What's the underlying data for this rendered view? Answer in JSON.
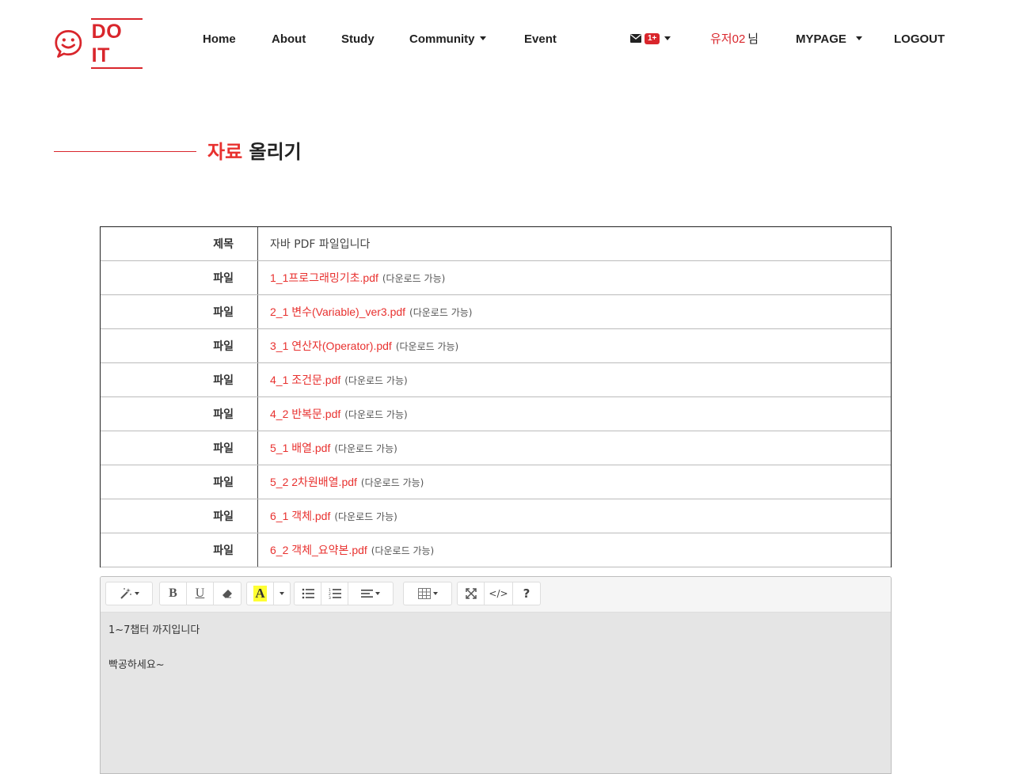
{
  "brand": {
    "name": "DO IT",
    "color": "#d9262c"
  },
  "nav": {
    "items": [
      "Home",
      "About",
      "Study",
      "Community",
      "Event"
    ],
    "message_badge": "1+",
    "user_name": "유저02",
    "user_suffix": "님",
    "mypage": "MYPAGE",
    "logout": "LOGOUT"
  },
  "page": {
    "title_highlight": "자료",
    "title_rest": " 올리기"
  },
  "table": {
    "title_label": "제목",
    "title_value": "자바 PDF 파일입니다",
    "file_label": "파일",
    "download_note": "(다운로드 가능)",
    "files": [
      "1_1프로그래밍기초.pdf",
      "2_1 변수(Variable)_ver3.pdf",
      "3_1 연산자(Operator).pdf",
      "4_1 조건문.pdf",
      "4_2 반복문.pdf",
      "5_1 배열.pdf",
      "5_2 2차원배열.pdf",
      "6_1 객체.pdf",
      "6_2 객체_요약본.pdf"
    ]
  },
  "editor": {
    "toolbar": {
      "style_icon": "magic-icon",
      "bold": "B",
      "underline": "U",
      "eraser_icon": "eraser-icon",
      "color": "A",
      "list_ul_icon": "list-ul-icon",
      "list_ol_icon": "list-ol-icon",
      "align_icon": "align-icon",
      "table_icon": "table-icon",
      "fullscreen_icon": "fullscreen-icon",
      "code": "</>",
      "help": "?"
    },
    "content": [
      "1~7챕터 까지입니다",
      "빡공하세요~"
    ]
  }
}
